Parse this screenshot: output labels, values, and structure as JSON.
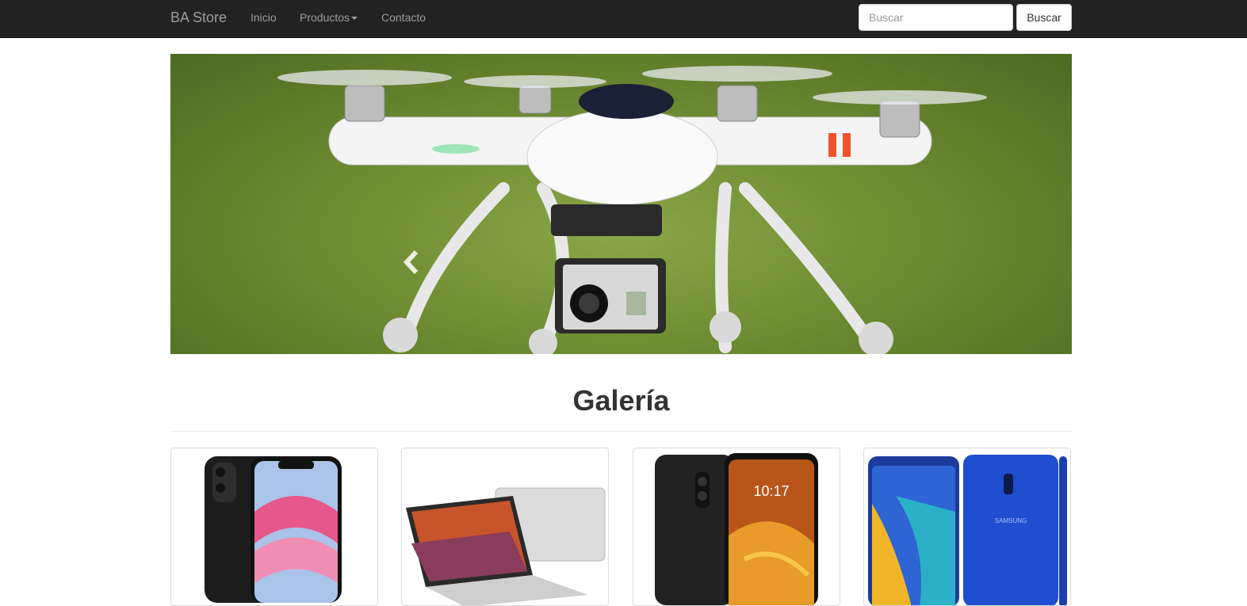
{
  "navbar": {
    "brand": "BA Store",
    "items": [
      {
        "label": "Inicio"
      },
      {
        "label": "Productos"
      },
      {
        "label": "Contacto"
      }
    ],
    "search": {
      "placeholder": "Buscar",
      "value": "",
      "button_label": "Buscar"
    }
  },
  "carousel": {
    "image": "drone-photo",
    "prev_icon": "chevron-left-icon",
    "next_icon": "chevron-right-icon"
  },
  "gallery": {
    "title": "Galería",
    "items": [
      {
        "image": "iphone-11-photo"
      },
      {
        "image": "asus-laptop-photo"
      },
      {
        "image": "pocophone-photo",
        "screen_time": "10:17"
      },
      {
        "image": "samsung-galaxy-photo",
        "brand_text": "SAMSUNG"
      }
    ]
  },
  "colors": {
    "navbar_bg": "#222222",
    "navbar_text": "#9d9d9d",
    "border": "#dddddd"
  }
}
